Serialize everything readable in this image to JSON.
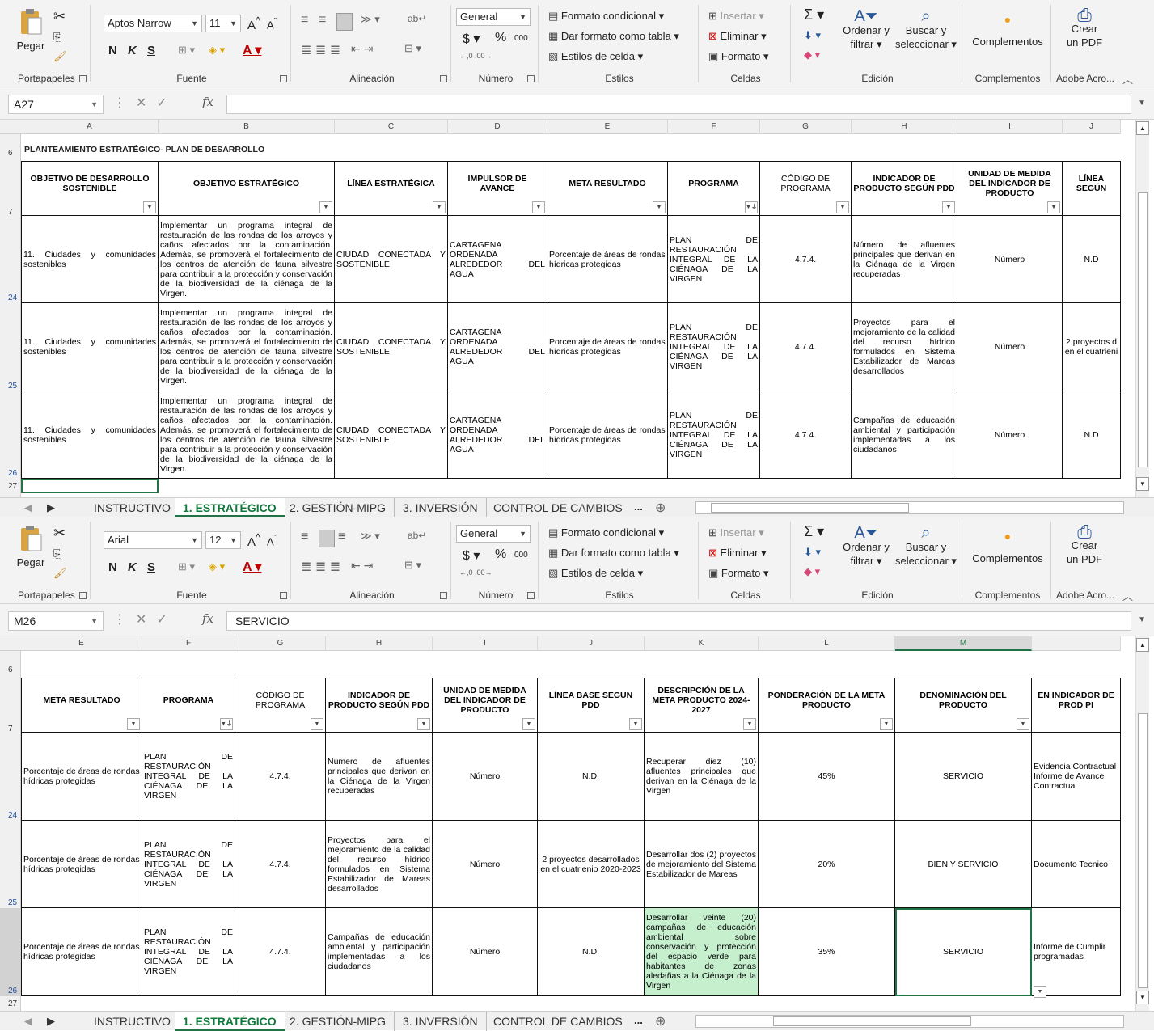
{
  "ribbon": {
    "paste_label": "Pegar",
    "portapapeles_label": "Portapapeles",
    "fuente_label": "Fuente",
    "bold": "N",
    "italic": "K",
    "underline": "S",
    "alineacion_label": "Alineación",
    "number_format": "General",
    "currency": "$",
    "percent": "%",
    "thousands": "000",
    "numero_label": "Número",
    "cond_format": "Formato condicional",
    "table_format": "Dar formato como tabla",
    "cell_styles": "Estilos de celda",
    "estilos_label": "Estilos",
    "insert": "Insertar",
    "delete": "Eliminar",
    "format": "Formato",
    "celdas_label": "Celdas",
    "sort_filter_1": "Ordenar y",
    "sort_filter_2": "filtrar",
    "find_1": "Buscar y",
    "find_2": "seleccionar",
    "edicion_label": "Edición",
    "addins": "Complementos",
    "addins_label": "Complementos",
    "pdf_1": "Crear",
    "pdf_2": "un PDF",
    "adobe_label": "Adobe Acro..."
  },
  "pane1": {
    "font_name": "Aptos Narrow",
    "font_size": "11",
    "name_box": "A27",
    "formula": "",
    "col_letters": [
      "A",
      "B",
      "C",
      "D",
      "E",
      "F",
      "G",
      "H",
      "I",
      "J"
    ],
    "title": "PLANTEAMIENTO ESTRATÉGICO- PLAN DE DESARROLLO",
    "headers": [
      "OBJETIVO DE DESARROLLO SOSTENIBLE",
      "OBJETIVO ESTRATÉGICO",
      "LÍNEA ESTRATÉGICA",
      "IMPULSOR DE AVANCE",
      "META RESULTADO",
      "PROGRAMA",
      "CÓDIGO DE PROGRAMA",
      "INDICADOR DE PRODUCTO SEGÚN PDD",
      "UNIDAD DE MEDIDA DEL INDICADOR DE PRODUCTO",
      "LÍNEA SEGÚN"
    ],
    "rows": [
      {
        "num": "24",
        "cells": [
          "11. Ciudades y comunidades sostenibles",
          "Implementar un programa integral de restauración de las rondas de los arroyos y caños afectados por la contaminación. Además, se promoverá el fortalecimiento de los centros de atención de fauna silvestre para contribuir a la protección y conservación de la biodiversidad de la ciénaga de la Virgen.",
          "CIUDAD CONECTADA Y SOSTENIBLE",
          "CARTAGENA ORDENADA ALREDEDOR DEL AGUA",
          "Porcentaje de áreas de rondas hídricas protegidas",
          "PLAN DE RESTAURACIÓN INTEGRAL DE LA CIÉNAGA DE LA VIRGEN",
          "4.7.4.",
          "Número de afluentes principales que derivan en la Ciénaga de la Virgen recuperadas",
          "Número",
          "N.D"
        ]
      },
      {
        "num": "25",
        "cells": [
          "11. Ciudades y comunidades sostenibles",
          "Implementar un programa integral de restauración de las rondas de los arroyos y caños afectados por la contaminación. Además, se promoverá el fortalecimiento de los centros de atención de fauna silvestre para contribuir a la protección y conservación de la biodiversidad de la ciénaga de la Virgen.",
          "CIUDAD CONECTADA Y SOSTENIBLE",
          "CARTAGENA ORDENADA ALREDEDOR DEL AGUA",
          "Porcentaje de áreas de rondas hídricas protegidas",
          "PLAN DE RESTAURACIÓN INTEGRAL DE LA CIÉNAGA DE LA VIRGEN",
          "4.7.4.",
          "Proyectos para el mejoramiento de la calidad del recurso hídrico formulados en Sistema Estabilizador de Mareas desarrollados",
          "Número",
          "2 proyectos d en el cuatrieni"
        ]
      },
      {
        "num": "26",
        "cells": [
          "11. Ciudades y comunidades sostenibles",
          "Implementar un programa integral de restauración de las rondas de los arroyos y caños afectados por la contaminación. Además, se promoverá el fortalecimiento de los centros de atención de fauna silvestre para contribuir a la protección y conservación de la biodiversidad de la ciénaga de la Virgen.",
          "CIUDAD CONECTADA Y SOSTENIBLE",
          "CARTAGENA ORDENADA ALREDEDOR DEL AGUA",
          "Porcentaje de áreas de rondas hídricas protegidas",
          "PLAN DE RESTAURACIÓN INTEGRAL DE LA CIÉNAGA DE LA VIRGEN",
          "4.7.4.",
          "Campañas de educación ambiental y participación implementadas a los ciudadanos",
          "Número",
          "N.D"
        ]
      }
    ]
  },
  "pane2": {
    "font_name": "Arial",
    "font_size": "12",
    "name_box": "M26",
    "formula": "SERVICIO",
    "col_letters": [
      "E",
      "F",
      "G",
      "H",
      "I",
      "J",
      "K",
      "L",
      "M",
      ""
    ],
    "headers": [
      "META RESULTADO",
      "PROGRAMA",
      "CÓDIGO DE PROGRAMA",
      "INDICADOR DE PRODUCTO SEGÚN PDD",
      "UNIDAD DE MEDIDA DEL INDICADOR DE PRODUCTO",
      "LÍNEA BASE SEGUN PDD",
      "DESCRIPCIÓN DE LA META PRODUCTO 2024-2027",
      "PONDERACIÓN DE LA META PRODUCTO",
      "DENOMINACIÓN DEL PRODUCTO",
      "EN INDICADOR DE PROD PI"
    ],
    "rows": [
      {
        "num": "24",
        "cells": [
          "Porcentaje de áreas de rondas hídricas protegidas",
          "PLAN DE RESTAURACIÓN INTEGRAL DE LA CIÉNAGA DE LA VIRGEN",
          "4.7.4.",
          "Número de afluentes principales que derivan en la Ciénaga de la Virgen recuperadas",
          "Número",
          "N.D.",
          "Recuperar diez (10) afluentes principales que derivan en la Ciénaga de la Virgen",
          "45%",
          "SERVICIO",
          "Evidencia Contractual Informe de Avance Contractual"
        ]
      },
      {
        "num": "25",
        "cells": [
          "Porcentaje de áreas de rondas hídricas protegidas",
          "PLAN DE RESTAURACIÓN INTEGRAL DE LA CIÉNAGA DE LA VIRGEN",
          "4.7.4.",
          "Proyectos para el mejoramiento de la calidad del recurso hídrico formulados en Sistema Estabilizador de Mareas desarrollados",
          "Número",
          "2 proyectos desarrollados en el cuatrienio 2020-2023",
          "Desarrollar dos (2) proyectos de mejoramiento del Sistema Estabilizador de Mareas",
          "20%",
          "BIEN Y SERVICIO",
          "Documento Tecnico"
        ]
      },
      {
        "num": "26",
        "cells": [
          "Porcentaje de áreas de rondas hídricas protegidas",
          "PLAN DE RESTAURACIÓN INTEGRAL DE LA CIÉNAGA DE LA VIRGEN",
          "4.7.4.",
          "Campañas de educación ambiental y participación implementadas a los ciudadanos",
          "Número",
          "N.D.",
          "Desarrollar veinte (20) campañas de educación ambiental sobre conservación y protección del espacio verde para habitantes de zonas aledañas a la Ciénaga de la Virgen",
          "35%",
          "SERVICIO",
          "Informe de Cumplir programadas"
        ]
      }
    ]
  },
  "tabs": [
    "INSTRUCTIVO",
    "1. ESTRATÉGICO",
    "2. GESTIÓN-MIPG",
    "3. INVERSIÓN",
    "CONTROL DE CAMBIOS",
    "..."
  ],
  "colors": {
    "accent": "#217346",
    "highlight_cell": "#c6efce"
  }
}
